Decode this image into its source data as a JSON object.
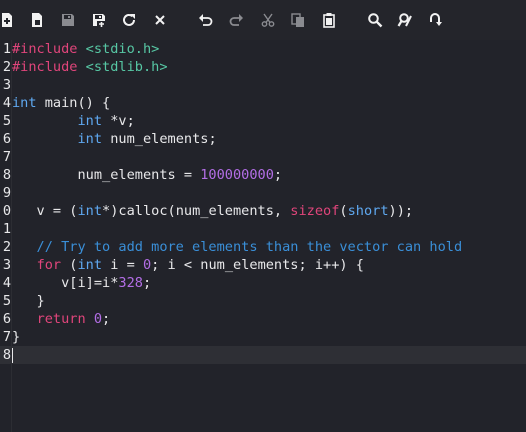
{
  "toolbar": {
    "buttons": [
      {
        "name": "new-file-icon"
      },
      {
        "name": "open-file-icon"
      },
      {
        "name": "save-icon"
      },
      {
        "name": "save-as-icon"
      },
      {
        "name": "reload-icon"
      },
      {
        "name": "close-icon"
      },
      {
        "name": "undo-icon"
      },
      {
        "name": "redo-icon"
      },
      {
        "name": "cut-icon"
      },
      {
        "name": "copy-icon"
      },
      {
        "name": "paste-icon"
      },
      {
        "name": "search-icon"
      },
      {
        "name": "replace-icon"
      },
      {
        "name": "goto-icon"
      }
    ]
  },
  "editor": {
    "current_line": "8",
    "lines": [
      {
        "num": "1",
        "tokens": [
          {
            "t": "#include ",
            "c": "pre"
          },
          {
            "t": "<stdio.h>",
            "c": "str"
          }
        ]
      },
      {
        "num": "2",
        "tokens": [
          {
            "t": "#include ",
            "c": "pre"
          },
          {
            "t": "<stdlib.h>",
            "c": "str"
          }
        ]
      },
      {
        "num": "3",
        "tokens": []
      },
      {
        "num": "4",
        "tokens": [
          {
            "t": "int",
            "c": "type"
          },
          {
            "t": " main() {",
            "c": "plain"
          }
        ]
      },
      {
        "num": "5",
        "tokens": [
          {
            "t": "        ",
            "c": "plain"
          },
          {
            "t": "int",
            "c": "type"
          },
          {
            "t": " *v;",
            "c": "plain"
          }
        ]
      },
      {
        "num": "6",
        "tokens": [
          {
            "t": "        ",
            "c": "plain"
          },
          {
            "t": "int",
            "c": "type"
          },
          {
            "t": " num_elements;",
            "c": "plain"
          }
        ]
      },
      {
        "num": "7",
        "tokens": []
      },
      {
        "num": "8",
        "tokens": [
          {
            "t": "        num_elements = ",
            "c": "plain"
          },
          {
            "t": "100000000",
            "c": "num"
          },
          {
            "t": ";",
            "c": "plain"
          }
        ]
      },
      {
        "num": "9",
        "tokens": []
      },
      {
        "num": "0",
        "tokens": [
          {
            "t": "   v = (",
            "c": "plain"
          },
          {
            "t": "int",
            "c": "type"
          },
          {
            "t": "*)calloc(num_elements, ",
            "c": "plain"
          },
          {
            "t": "sizeof",
            "c": "kw"
          },
          {
            "t": "(",
            "c": "plain"
          },
          {
            "t": "short",
            "c": "type"
          },
          {
            "t": "));",
            "c": "plain"
          }
        ]
      },
      {
        "num": "1",
        "tokens": []
      },
      {
        "num": "2",
        "tokens": [
          {
            "t": "   // Try to add more elements than the vector can hold",
            "c": "com"
          }
        ]
      },
      {
        "num": "3",
        "tokens": [
          {
            "t": "   ",
            "c": "plain"
          },
          {
            "t": "for",
            "c": "kw"
          },
          {
            "t": " (",
            "c": "plain"
          },
          {
            "t": "int",
            "c": "type"
          },
          {
            "t": " i = ",
            "c": "plain"
          },
          {
            "t": "0",
            "c": "num"
          },
          {
            "t": "; i < num_elements; i++) {",
            "c": "plain"
          }
        ]
      },
      {
        "num": "4",
        "tokens": [
          {
            "t": "      v[i]=i*",
            "c": "plain"
          },
          {
            "t": "328",
            "c": "num"
          },
          {
            "t": ";",
            "c": "plain"
          }
        ]
      },
      {
        "num": "5",
        "tokens": [
          {
            "t": "   }",
            "c": "plain"
          }
        ]
      },
      {
        "num": "6",
        "tokens": [
          {
            "t": "   ",
            "c": "plain"
          },
          {
            "t": "return",
            "c": "kw"
          },
          {
            "t": " ",
            "c": "plain"
          },
          {
            "t": "0",
            "c": "num"
          },
          {
            "t": ";",
            "c": "plain"
          }
        ]
      },
      {
        "num": "7",
        "tokens": [
          {
            "t": "}",
            "c": "plain"
          }
        ]
      },
      {
        "num": "8",
        "tokens": []
      }
    ]
  },
  "colors": {
    "background": "#22232a",
    "current_line": "#2e2f35",
    "plain": "#e8e8ea",
    "pre": "#e0457b",
    "str": "#57c7a4",
    "type": "#5fa8f0",
    "kw": "#e0457b",
    "num": "#b36ee6",
    "com": "#3a8fd8",
    "icon": "#f2f2f2",
    "icon_dim": "#8a8b90"
  }
}
